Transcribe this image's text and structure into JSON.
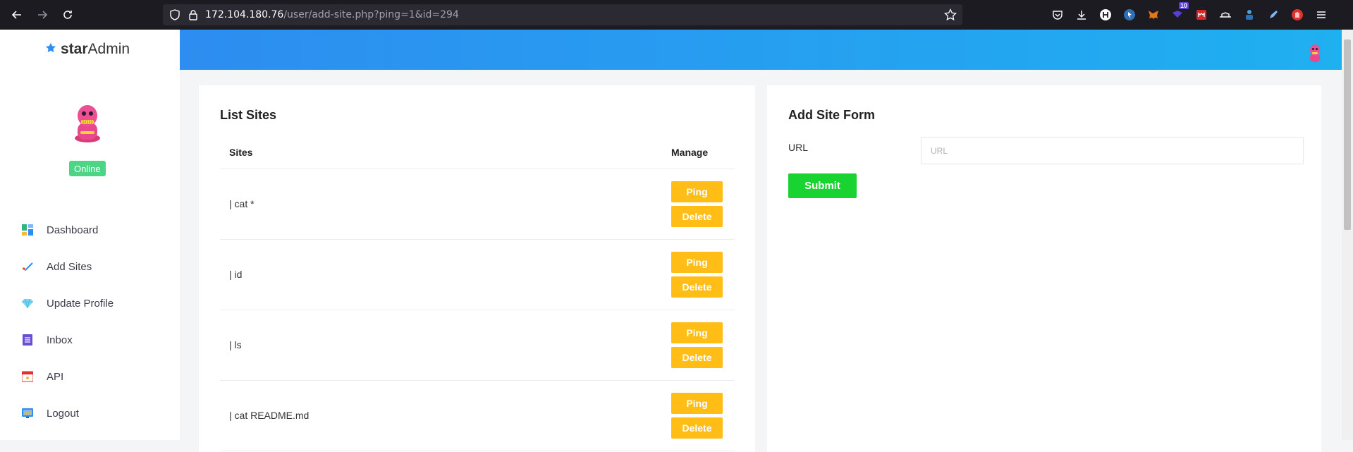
{
  "browser": {
    "url_host": "172.104.180.76",
    "url_path": "/user/add-site.php?ping=1&id=294",
    "ext_badge": "10"
  },
  "brand": {
    "prefix": "star",
    "suffix": "Admin"
  },
  "profile": {
    "status": "Online"
  },
  "sidebar": {
    "items": [
      {
        "label": "Dashboard",
        "icon": "dashboard-icon"
      },
      {
        "label": "Add Sites",
        "icon": "add-sites-icon"
      },
      {
        "label": "Update Profile",
        "icon": "diamond-icon"
      },
      {
        "label": "Inbox",
        "icon": "inbox-icon"
      },
      {
        "label": "API",
        "icon": "api-icon"
      },
      {
        "label": "Logout",
        "icon": "logout-icon"
      }
    ]
  },
  "list": {
    "title": "List Sites",
    "col_sites": "Sites",
    "col_manage": "Manage",
    "rows": [
      {
        "site": "| cat *",
        "ping": "Ping",
        "delete": "Delete"
      },
      {
        "site": "| id",
        "ping": "Ping",
        "delete": "Delete"
      },
      {
        "site": "| ls",
        "ping": "Ping",
        "delete": "Delete"
      },
      {
        "site": "| cat README.md",
        "ping": "Ping",
        "delete": "Delete"
      }
    ]
  },
  "form": {
    "title": "Add Site Form",
    "url_label": "URL",
    "url_placeholder": "URL",
    "submit": "Submit"
  },
  "colors": {
    "topbar_start": "#2d8df0",
    "topbar_end": "#1fb0f0",
    "button_yellow": "#ffbd16",
    "button_green": "#19d430",
    "status_green": "#4cd684"
  }
}
